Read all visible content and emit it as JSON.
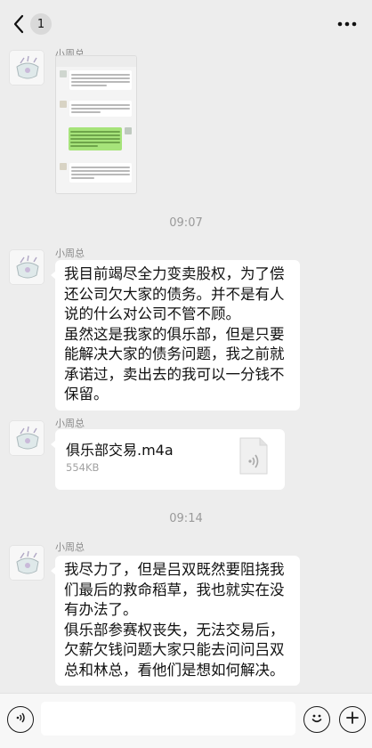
{
  "topbar": {
    "unread_count": "1"
  },
  "messages": [
    {
      "sender": "小周总",
      "type": "image"
    },
    {
      "time": "09:07"
    },
    {
      "sender": "小周总",
      "type": "text",
      "paragraphs": [
        "我目前竭尽全力变卖股权，为了偿还公司欠大家的债务。并不是有人说的什么对公司不管不顾。",
        "虽然这是我家的俱乐部，但是只要能解决大家的债务问题，我之前就承诺过，卖出去的我可以一分钱不保留。"
      ]
    },
    {
      "sender": "小周总",
      "type": "file",
      "file_name": "俱乐部交易.m4a",
      "file_size": "554KB"
    },
    {
      "time": "09:14"
    },
    {
      "sender": "小周总",
      "type": "text",
      "paragraphs": [
        "我尽力了，但是吕双既然要阻挠我们最后的救命稻草，我也就实在没有办法了。",
        "俱乐部参赛权丧失，无法交易后，欠薪欠钱问题大家只能去问问吕双总和林总，看他们是想如何解决。"
      ]
    }
  ],
  "icons": {
    "back": "chevron-left-icon",
    "more": "more-dots-icon",
    "voice": "voice-icon",
    "emoji": "emoji-icon",
    "plus": "plus-icon",
    "file": "audio-file-icon"
  },
  "colors": {
    "background": "#ededed",
    "bubble": "#ffffff",
    "timestamp": "#9a9a9a",
    "sender": "#8a8a8a"
  }
}
